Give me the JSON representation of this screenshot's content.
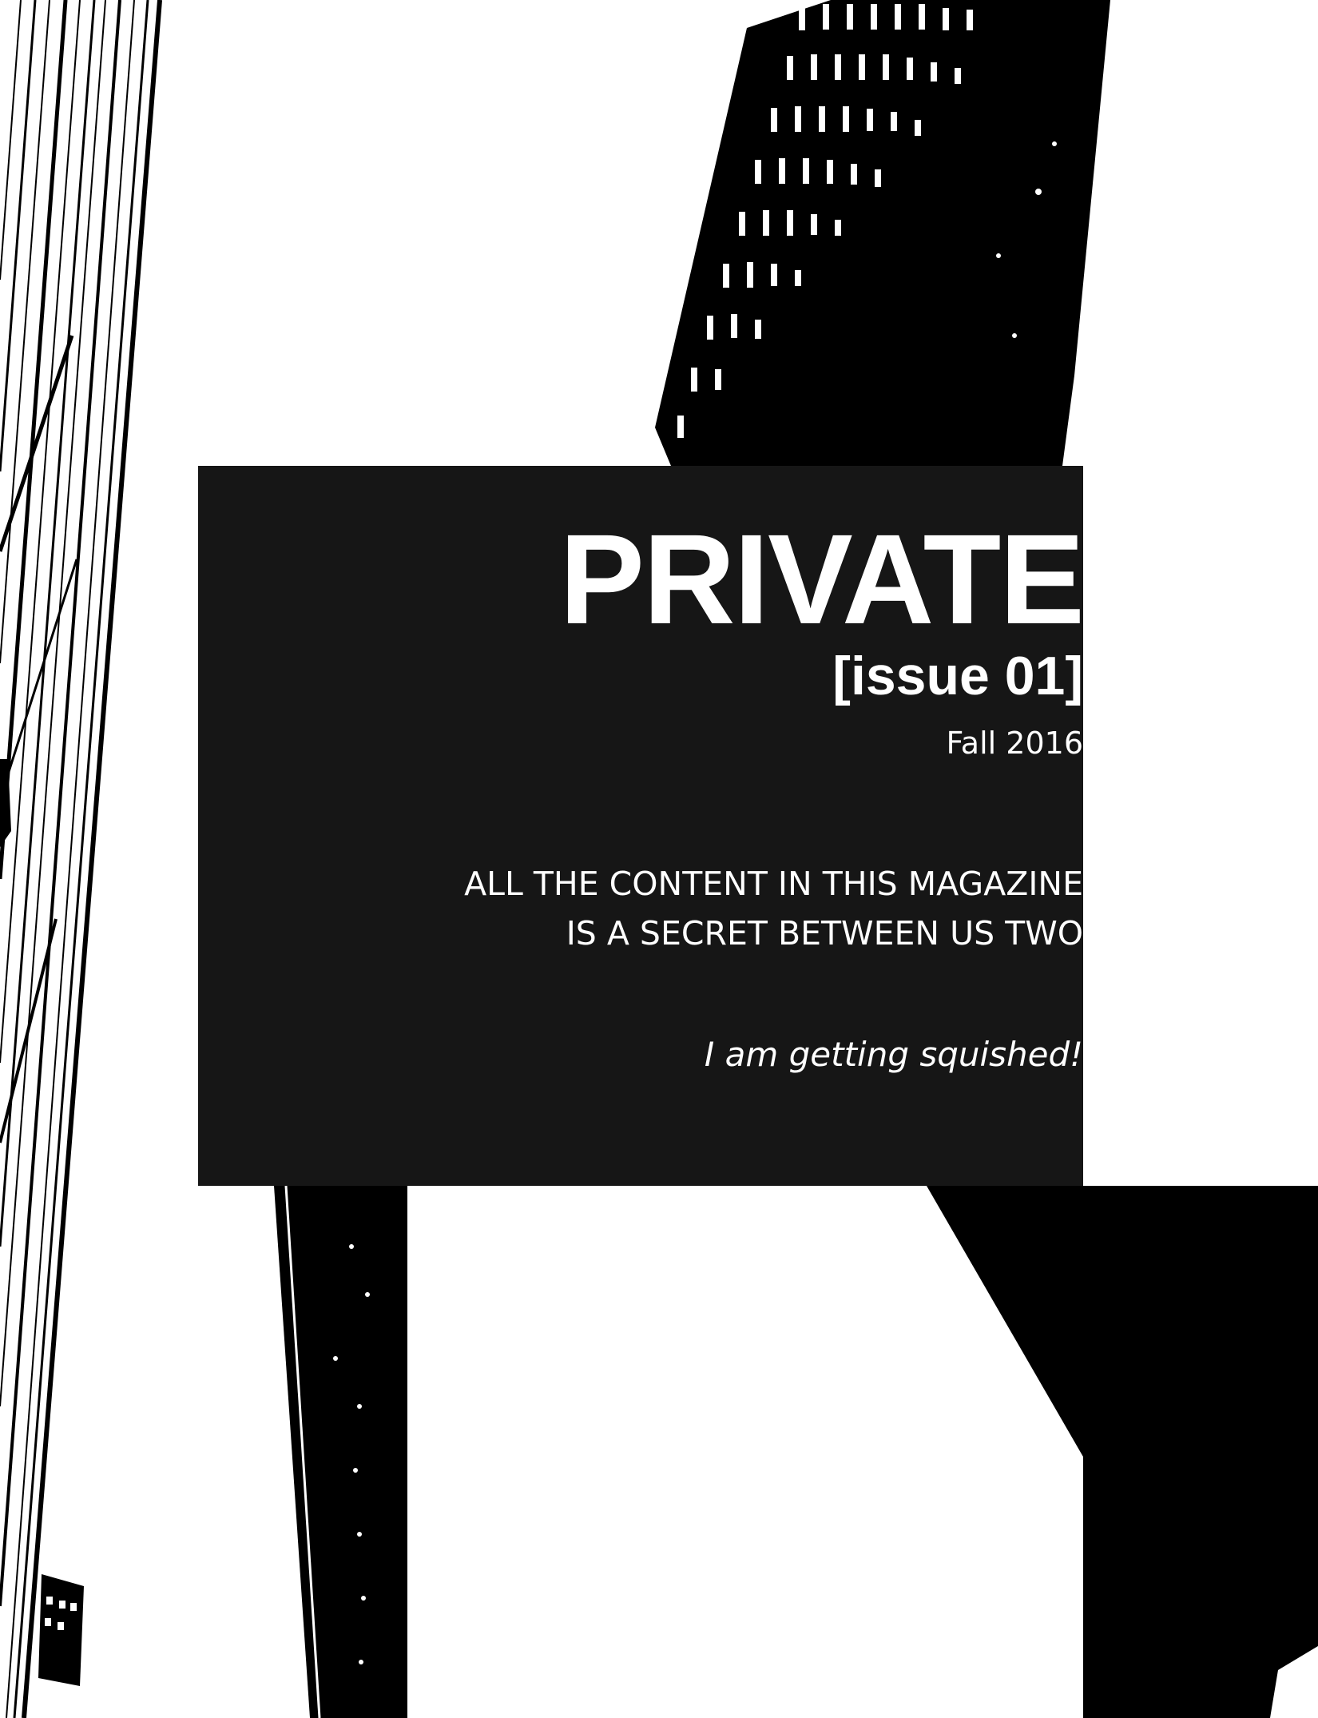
{
  "cover": {
    "title": "PRIVATE",
    "issue": "[issue 01]",
    "season": "Fall 2016",
    "tagline": [
      "ALL THE CONTENT IN THIS MAGAZINE",
      "IS A SECRET BETWEEN US TWO"
    ],
    "quote": "I am getting squished!"
  },
  "colors": {
    "panel": "#161616",
    "ink": "#000000",
    "paper": "#ffffff",
    "text": "#ffffff"
  }
}
